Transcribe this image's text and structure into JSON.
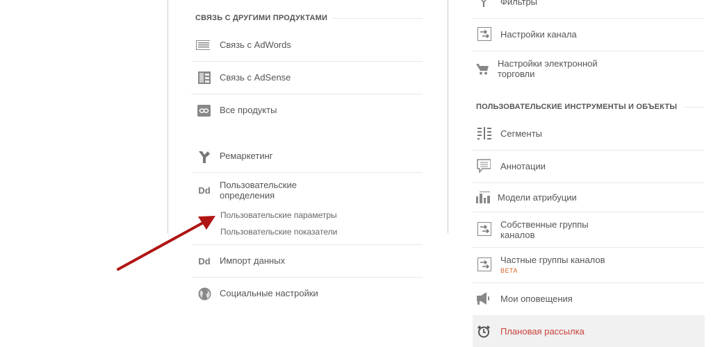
{
  "left": {
    "section_header": "СВЯЗЬ С ДРУГИМИ ПРОДУКТАМИ",
    "items": [
      {
        "label": "Связь с AdWords",
        "icon": "adwords-icon"
      },
      {
        "label": "Связь с AdSense",
        "icon": "adsense-icon"
      },
      {
        "label": "Все продукты",
        "icon": "link-icon"
      },
      {
        "label": "Ремаркетинг",
        "icon": "remarketing-icon"
      },
      {
        "label": "Пользовательские",
        "label2": "определения",
        "icon": "dd-icon",
        "icon_text": "Dd",
        "subitems": [
          "Пользовательские параметры",
          "Пользовательские показатели"
        ]
      },
      {
        "label": "Импорт данных",
        "icon": "dd-icon",
        "icon_text": "Dd"
      },
      {
        "label": "Социальные настройки",
        "icon": "globe-icon"
      }
    ]
  },
  "right": {
    "items_top": [
      {
        "label": "Фильтры",
        "icon": "filter-icon"
      },
      {
        "label": "Настройки канала",
        "icon": "channel-settings-icon"
      },
      {
        "label": "Настройки электронной",
        "label2": "торговли",
        "icon": "cart-icon"
      }
    ],
    "section_header": "ПОЛЬЗОВАТЕЛЬСКИЕ ИНСТРУМЕНТЫ И ОБЪЕКТЫ",
    "items": [
      {
        "label": "Сегменты",
        "icon": "segments-icon"
      },
      {
        "label": "Аннотации",
        "icon": "annotation-icon"
      },
      {
        "label": "Модели атрибуции",
        "icon": "attribution-icon"
      },
      {
        "label": "Собственные группы",
        "label2": "каналов",
        "icon": "channel-groups-icon"
      },
      {
        "label": "Частные группы каналов",
        "badge": "BETA",
        "icon": "channel-groups-icon"
      },
      {
        "label": "Мои оповещения",
        "icon": "megaphone-icon"
      },
      {
        "label": "Плановая рассылка",
        "icon": "alarm-clock-icon",
        "selected": true
      }
    ]
  },
  "colors": {
    "accent_selected": "#c8413a",
    "arrow": "#b01515",
    "beta": "#d9662a"
  }
}
